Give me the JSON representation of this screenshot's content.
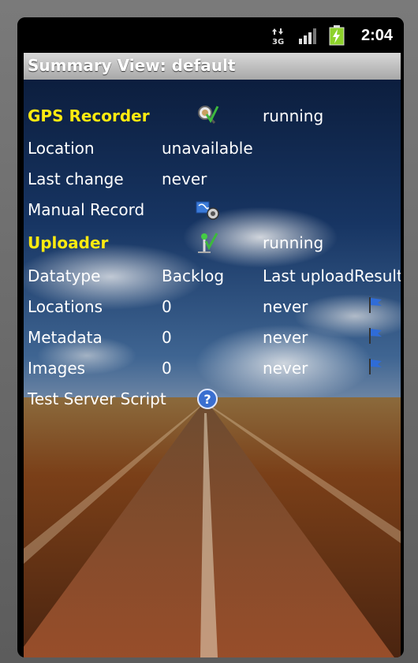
{
  "status_bar": {
    "time": "2:04",
    "network_type": "3G",
    "icons": [
      "data-arrows-icon",
      "signal-bars-icon",
      "battery-charging-icon"
    ]
  },
  "title": "Summary View: default",
  "gps": {
    "label": "GPS Recorder",
    "status": "running",
    "icon": "gps-check-icon",
    "location_label": "Location",
    "location_value": "unavailable",
    "last_change_label": "Last change",
    "last_change_value": "never",
    "manual_record_label": "Manual Record",
    "manual_record_icon": "manual-record-icon"
  },
  "uploader": {
    "label": "Uploader",
    "status": "running",
    "icon": "uploader-check-icon",
    "columns": {
      "datatype": "Datatype",
      "backlog": "Backlog",
      "last_upload": "Last upload",
      "result": "Result"
    },
    "rows": [
      {
        "name": "Locations",
        "backlog": "0",
        "last_upload": "never",
        "result_icon": "flag-icon"
      },
      {
        "name": "Metadata",
        "backlog": "0",
        "last_upload": "never",
        "result_icon": "flag-icon"
      },
      {
        "name": "Images",
        "backlog": "0",
        "last_upload": "never",
        "result_icon": "flag-icon"
      }
    ]
  },
  "test_server": {
    "label": "Test Server Script",
    "icon": "help-question-icon"
  },
  "colors": {
    "header_yellow": "#ffea10",
    "text": "#ffffff",
    "titlebar": "#b8b8b8"
  }
}
